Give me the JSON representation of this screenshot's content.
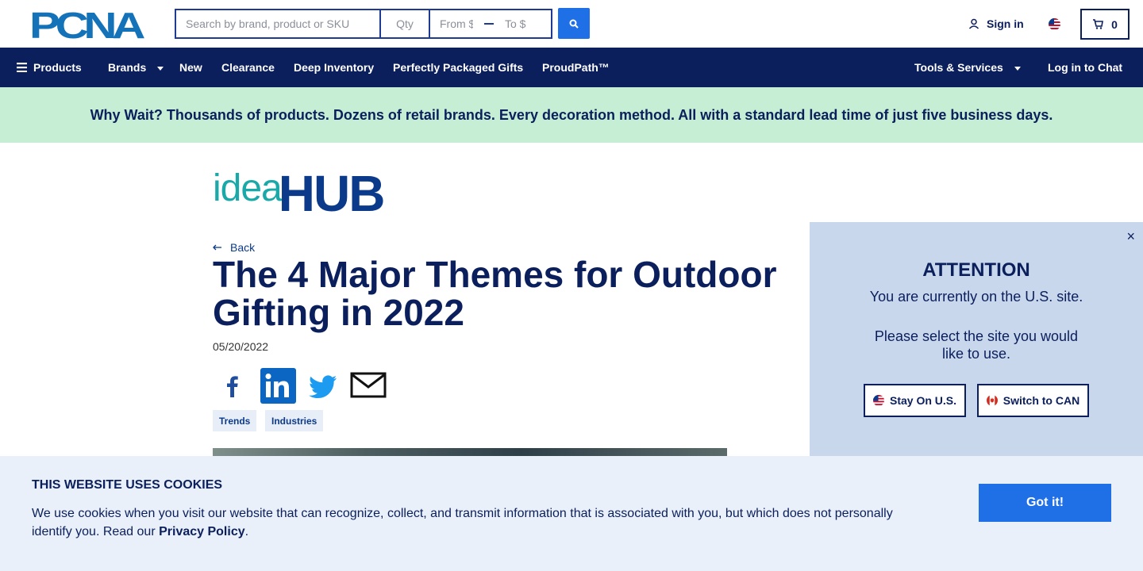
{
  "header": {
    "logo_text": "PCNA",
    "search": {
      "placeholder": "Search by brand, product or SKU",
      "value": ""
    },
    "qty": {
      "placeholder": "Qty",
      "value": ""
    },
    "price_from": {
      "placeholder": "From $",
      "value": ""
    },
    "price_to": {
      "placeholder": "To $",
      "value": ""
    },
    "signin_label": "Sign in",
    "cart_count": "0"
  },
  "nav": {
    "products": "Products",
    "brands": "Brands",
    "new": "New",
    "clearance": "Clearance",
    "deep_inventory": "Deep Inventory",
    "perfectly_packaged": "Perfectly Packaged Gifts",
    "proudpath": "ProudPath™",
    "tools_services": "Tools & Services",
    "log_in_chat": "Log in to Chat"
  },
  "banner": {
    "text": "Why Wait? Thousands of products. Dozens of retail brands. Every decoration method. All with a standard lead time of just five business days."
  },
  "article": {
    "brand_idea": "idea",
    "brand_hub": "HUB",
    "back_label": "Back",
    "title": "The 4 Major Themes for Outdoor Gifting in 2022",
    "date": "05/20/2022",
    "share_icons": [
      "facebook-icon",
      "linkedin-icon",
      "twitter-icon",
      "email-icon"
    ],
    "tags": [
      "Trends",
      "Industries"
    ]
  },
  "attention": {
    "title": "ATTENTION",
    "line1": "You are currently on the U.S. site.",
    "line2": "Please select the site you would like to use.",
    "stay_label": "Stay On U.S.",
    "switch_label": "Switch to CAN",
    "close_symbol": "×"
  },
  "cookies": {
    "title": "THIS WEBSITE USES COOKIES",
    "text": "We use cookies when you visit our website that can recognize, collect, and transmit information that is associated with you, but which does not personally identify you. Read our ",
    "link": "Privacy Policy",
    "end": ".",
    "button": "Got it!"
  },
  "colors": {
    "navy": "#0b1f5c",
    "accent_blue": "#1f6fe6",
    "banner_green": "#c5eed4",
    "modal_bg": "#c8d7ec",
    "cookie_bg": "#e9f0f9",
    "teal": "#1aa9a8"
  }
}
